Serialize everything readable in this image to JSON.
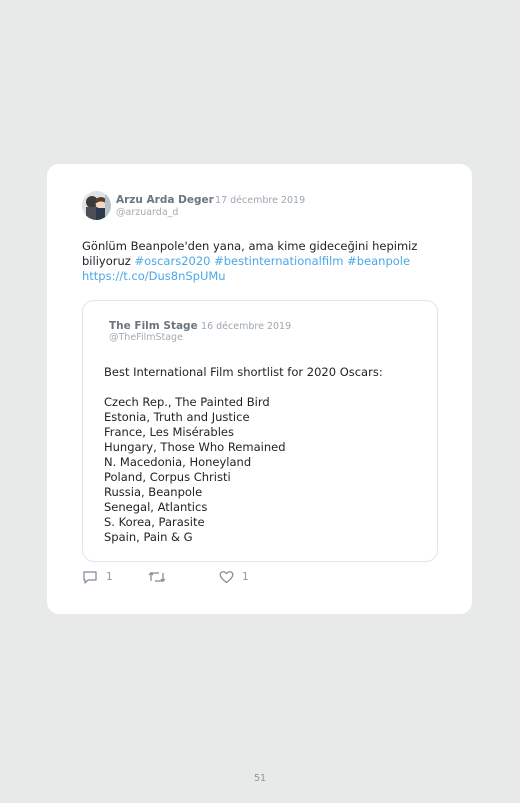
{
  "tweet": {
    "author_name": "Arzu Arda Deger",
    "date": "· 17 décembre 2019",
    "handle": "@arzuarda_d",
    "text_line1": "Gönlüm Beanpole'den yana, ama kime gideceğini hepimiz",
    "text_line2_plain": "biliyoruz ",
    "hashtags": "#oscars2020 #bestinternationalfilm #beanpole",
    "link": "https://t.co/Dus8nSpUMu",
    "avatar_icon": "avatar-photo-icon"
  },
  "quoted": {
    "author_name": "The Film Stage",
    "date": "· 16 décembre 2019",
    "handle": "@TheFilmStage",
    "headline": "Best International Film shortlist for 2020 Oscars:",
    "entries": [
      "Czech Rep., The Painted Bird",
      "Estonia, Truth and Justice",
      "France, Les Misérables",
      "Hungary, Those Who Remained",
      "N. Macedonia, Honeyland",
      "Poland, Corpus Christi",
      "Russia, Beanpole",
      "Senegal, Atlantics",
      "S. Korea, Parasite",
      "Spain, Pain & G"
    ]
  },
  "actions": {
    "reply_count": "1",
    "retweet_count": "",
    "like_count": "1",
    "reply_icon": "reply-icon",
    "retweet_icon": "retweet-icon",
    "like_icon": "heart-icon"
  },
  "page": {
    "number": "51"
  }
}
